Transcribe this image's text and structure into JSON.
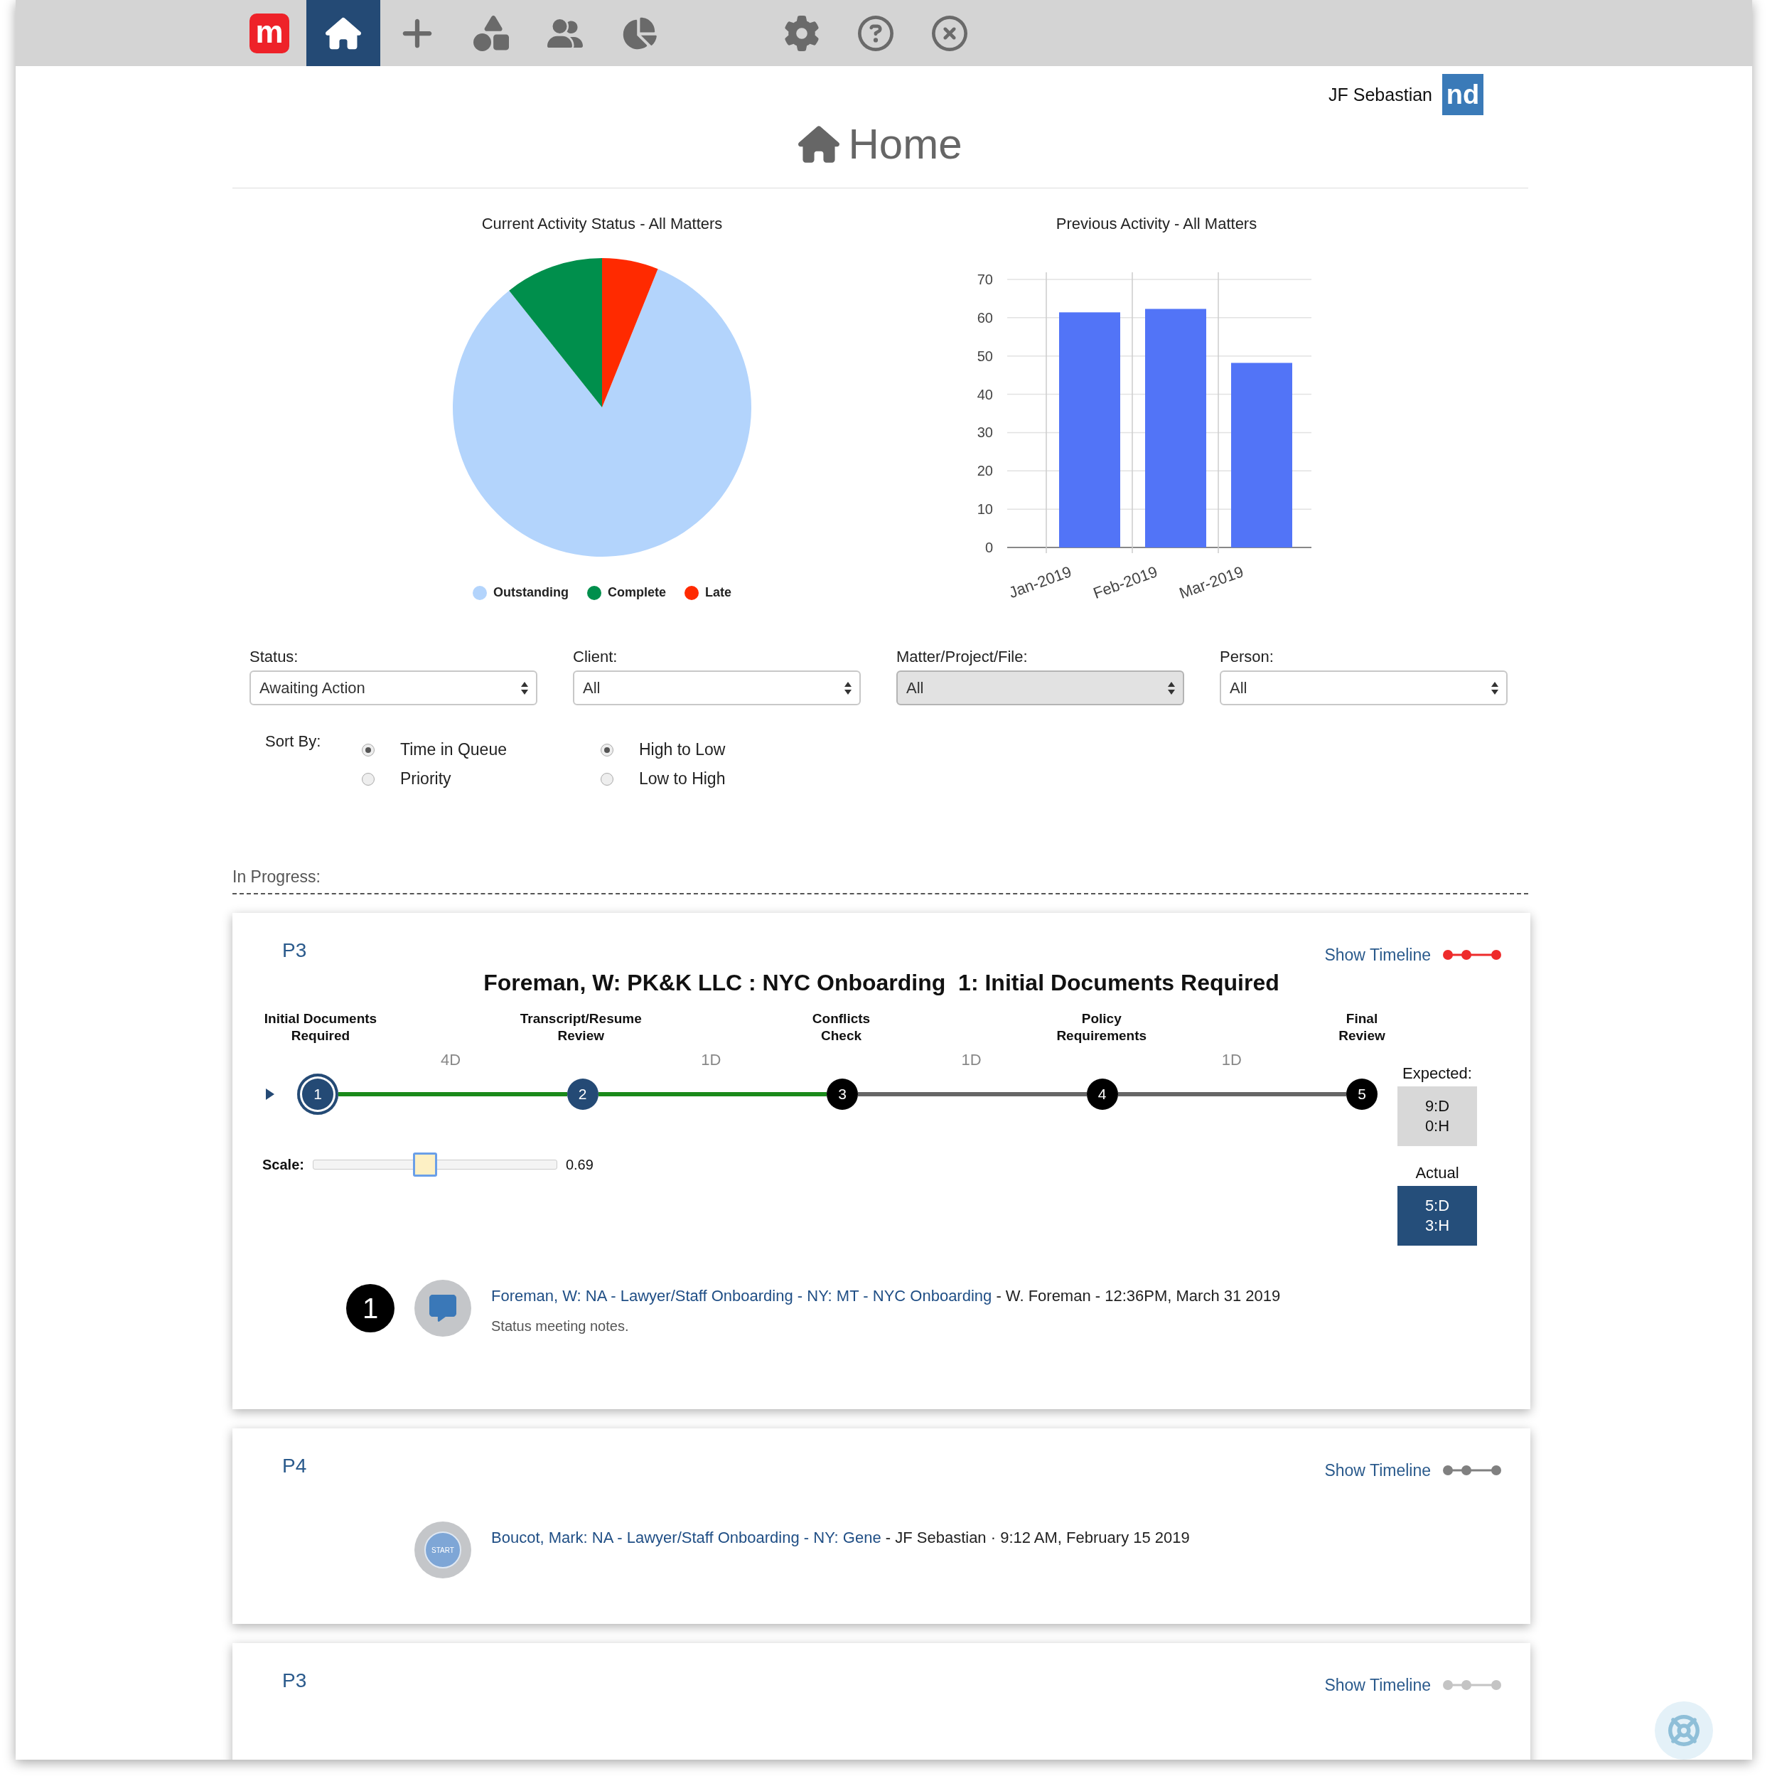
{
  "toolbar": {
    "items": [
      {
        "kind": "logo",
        "text": "m",
        "selected": false
      },
      {
        "kind": "home",
        "selected": true
      },
      {
        "kind": "add",
        "selected": false
      },
      {
        "kind": "shapes",
        "selected": false
      },
      {
        "kind": "people",
        "selected": false
      },
      {
        "kind": "chart",
        "selected": false
      },
      {
        "kind": "settings",
        "selected": false
      },
      {
        "kind": "help",
        "selected": false
      },
      {
        "kind": "close",
        "selected": false
      }
    ]
  },
  "user": {
    "name": "JF Sebastian",
    "badge": "nd"
  },
  "page_title": "Home",
  "pie_chart": {
    "title": "Current Activity Status - All Matters",
    "legend": [
      {
        "label": "Outstanding",
        "color": "#b3d4fc"
      },
      {
        "label": "Complete",
        "color": "#008f4c"
      },
      {
        "label": "Late",
        "color": "#ff2a00"
      }
    ]
  },
  "bar_chart": {
    "chart_data": {
      "type": "bar",
      "title": "Previous Activity - All Matters",
      "categories": [
        "Jan-2019",
        "Feb-2019",
        "Mar-2019"
      ],
      "series": [
        {
          "color": "#5274f7",
          "values": [
            61.4,
            62.3,
            48.2
          ]
        }
      ],
      "grid": true,
      "ylim": [
        0,
        70
      ],
      "yticks": [
        0,
        10,
        20,
        30,
        40,
        50,
        60,
        70
      ]
    }
  },
  "filters": [
    {
      "label": "Status:",
      "value": "Awaiting Action",
      "disabled": false
    },
    {
      "label": "Client:",
      "value": "All",
      "disabled": false
    },
    {
      "label": "Matter/Project/File:",
      "value": "All",
      "disabled": true
    },
    {
      "label": "Person:",
      "value": "All",
      "disabled": false
    }
  ],
  "sort": {
    "label": "Sort By:",
    "groups": [
      {
        "options": [
          {
            "label": "Time in Queue",
            "selected": true
          },
          {
            "label": "Priority",
            "selected": false
          }
        ]
      },
      {
        "options": [
          {
            "label": "High to Low",
            "selected": true
          },
          {
            "label": "Low to High",
            "selected": false
          }
        ]
      }
    ]
  },
  "section_title": "In Progress:",
  "cards": [
    {
      "priority": "P3",
      "link": "Show Timeline",
      "color": "#ee2b2b",
      "title": "Foreman, W: PK&K LLC : NYC Onboarding  1: Initial Documents Required",
      "steps": [
        {
          "label": "Initial Documents\nRequired",
          "number": "1",
          "complete": true,
          "selected": true
        },
        {
          "label": "Transcript/Resume\nReview",
          "number": "2",
          "complete": true,
          "selected": false
        },
        {
          "label": "Conflicts\nCheck",
          "number": "3",
          "complete": false,
          "selected": false
        },
        {
          "label": "Policy\nRequirements",
          "number": "4",
          "complete": false,
          "selected": false
        },
        {
          "label": "Final\nReview",
          "number": "5",
          "complete": false,
          "selected": false
        }
      ],
      "durations": [
        "4D",
        "1D",
        "1D",
        "1D"
      ],
      "expected": {
        "label": "Expected:",
        "lines": [
          "9:D",
          "0:H"
        ]
      },
      "actual": {
        "label": "Actual",
        "lines": [
          "5:D",
          "3:H"
        ]
      },
      "scale": {
        "label": "Scale:",
        "level": 0.46,
        "reading": "0.69"
      },
      "entries": [
        {
          "kind": "comment",
          "count": "1",
          "link": "Foreman, W: NA - Lawyer/Staff Onboarding - NY: MT - NYC Onboarding",
          "meta": "- W. Foreman - 12:36PM, March 31 2019",
          "note": "Status meeting notes."
        }
      ]
    },
    {
      "priority": "P4",
      "link": "Show Timeline",
      "color": "#808080",
      "entries": [
        {
          "kind": "start",
          "icon_text": "START",
          "link": "Boucot, Mark: NA - Lawyer/Staff Onboarding - NY: Gene",
          "meta": "- JF Sebastian · 9:12 AM, February 15 2019"
        }
      ]
    },
    {
      "priority": "P3",
      "link": "Show Timeline",
      "color": "#c4c4c4"
    }
  ]
}
